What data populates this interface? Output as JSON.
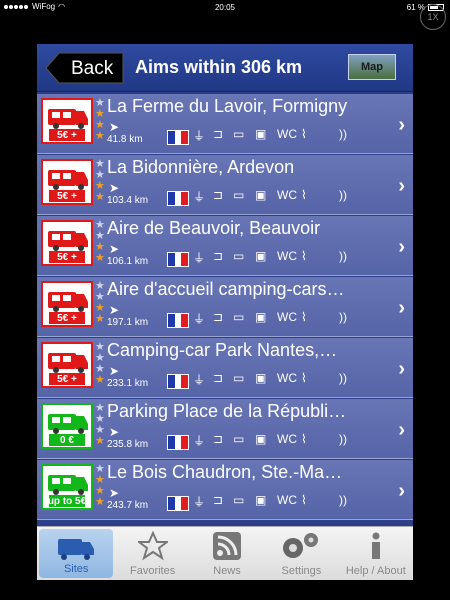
{
  "status": {
    "carrier": "WiFog",
    "time": "20:05",
    "battery": "61 %"
  },
  "zoom_badge": "1X",
  "navbar": {
    "back_label": "Back",
    "title": "Aims within 306 km",
    "map_label": "Map"
  },
  "rows": [
    {
      "title": "La Ferme du Lavoir, Formigny",
      "distance": "41.8 km",
      "price": "5€ +",
      "color": "#e01818",
      "stars": 3
    },
    {
      "title": "La Bidonnière, Ardevon",
      "distance": "103.4 km",
      "price": "5€ +",
      "color": "#e01818",
      "stars": 2
    },
    {
      "title": "Aire de Beauvoir, Beauvoir",
      "distance": "106.1 km",
      "price": "5€ +",
      "color": "#e01818",
      "stars": 2
    },
    {
      "title": "Aire d'accueil camping-cars…",
      "distance": "197.1 km",
      "price": "5€ +",
      "color": "#e01818",
      "stars": 2
    },
    {
      "title": "Camping-car Park Nantes,…",
      "distance": "233.1 km",
      "price": "5€ +",
      "color": "#e01818",
      "stars": 1
    },
    {
      "title": "Parking Place de la Républi…",
      "distance": "235.8 km",
      "price": "0 €",
      "color": "#12b81a",
      "stars": 1
    },
    {
      "title": "Le Bois Chaudron, Ste.-Ma…",
      "distance": "243.7 km",
      "price": "up to 5€",
      "color": "#12b81a",
      "stars": 3
    }
  ],
  "tabs": [
    {
      "label": "Sites",
      "icon": "camper-icon"
    },
    {
      "label": "Favorites",
      "icon": "star-icon"
    },
    {
      "label": "News",
      "icon": "rss-icon"
    },
    {
      "label": "Settings",
      "icon": "gear-icon"
    },
    {
      "label": "Help / About",
      "icon": "info-icon"
    }
  ]
}
